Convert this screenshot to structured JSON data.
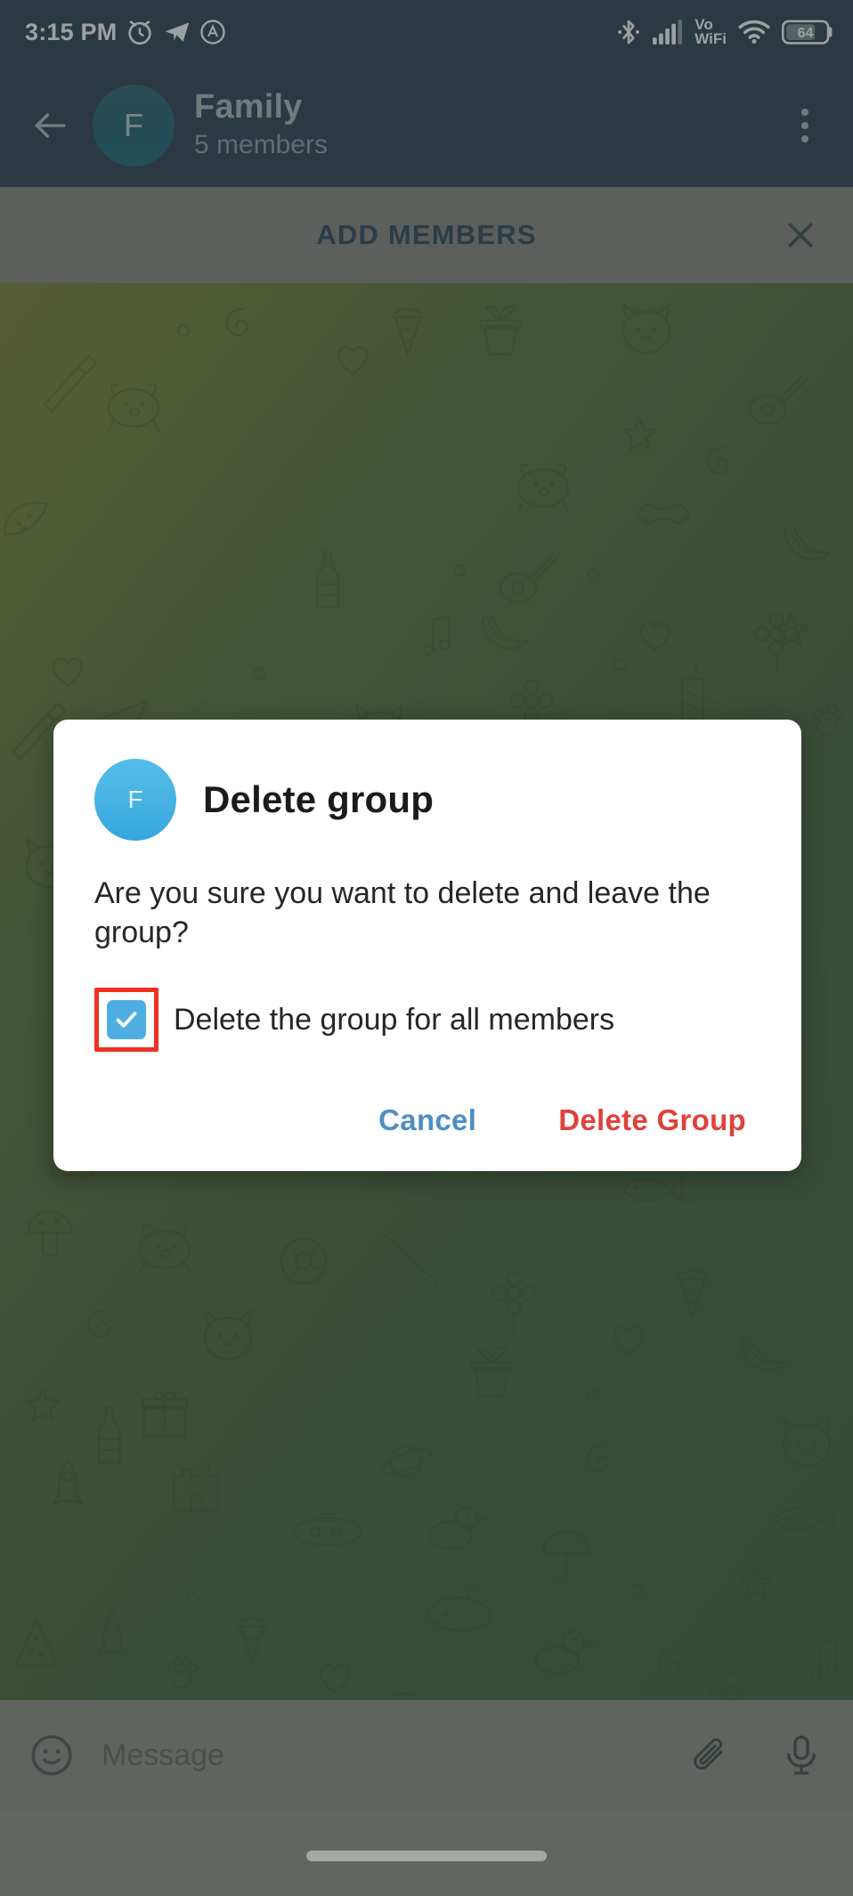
{
  "status_bar": {
    "time": "3:15 PM",
    "left_icons": [
      "alarm-clock-icon",
      "telegram-icon",
      "app-badge-icon"
    ],
    "right_icons": [
      "bluetooth-icon",
      "cellular-signal-icon",
      "vowifi-icon",
      "wifi-icon",
      "battery-icon"
    ],
    "vowifi_line1": "Vo",
    "vowifi_line2": "WiFi",
    "battery_level": "64",
    "background_color": "#2d4257"
  },
  "chat_header": {
    "back_icon": "back-arrow-icon",
    "avatar_letter": "F",
    "title": "Family",
    "subtitle": "5 members",
    "menu_icon": "overflow-menu-icon"
  },
  "add_members_bar": {
    "label": "ADD MEMBERS",
    "close_icon": "close-icon",
    "background_color": "#848484",
    "text_color": "#2d4960"
  },
  "dialog": {
    "avatar_letter": "F",
    "title": "Delete group",
    "message": "Are you sure you want to delete and leave the group?",
    "checkbox": {
      "label": "Delete the group for all members",
      "checked": true,
      "checkbox_color": "#4eaee2",
      "highlight_color": "#ef3124"
    },
    "cancel_label": "Cancel",
    "cancel_color": "#4d8fc4",
    "delete_label": "Delete Group",
    "delete_color": "#e0413a"
  },
  "message_bar": {
    "emoji_icon": "emoji-smiley-icon",
    "placeholder": "Message",
    "attach_icon": "paperclip-icon",
    "mic_icon": "microphone-icon"
  },
  "nav_bar": {
    "gesture_pill": "home-gesture-pill"
  }
}
